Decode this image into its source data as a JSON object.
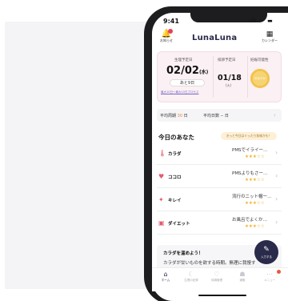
{
  "status": {
    "time": "9:41",
    "indicators": "ıll ≈ ▬"
  },
  "header": {
    "left_icon": "bell-icon",
    "left_label": "お知らせ",
    "logo": "LunaLuna",
    "right_icon": "calendar-icon",
    "right_label": "カレンダー"
  },
  "prediction": {
    "period_label": "生理予定日",
    "period_date": "02/02",
    "period_weekday": "(水)",
    "days_left": "あと9日",
    "link_text": "最大10日〜最大10日プロセス",
    "ovulation_label": "排卵予定日",
    "ovulation_date": "01/18",
    "ovulation_weekday": "(火)",
    "chance_label": "妊娠可能性",
    "chance_value": "ゆるやか"
  },
  "cycle": {
    "avg_cycle_label": "平均周期",
    "avg_cycle_value": "30",
    "avg_cycle_unit": "日",
    "avg_days_label": "平均日数",
    "avg_days_value": "--",
    "avg_days_unit": "日"
  },
  "today": {
    "title": "今日のあなた",
    "tag": "きっと今日はぐったり気味かも！",
    "rows": [
      {
        "icon": "thermometer-icon",
        "name": "カラダ",
        "desc": "PMSでイライー…",
        "stars": "★★★☆☆"
      },
      {
        "icon": "heart-icon",
        "name": "ココロ",
        "desc": "PMSよりもさー…",
        "stars": "★★★☆☆"
      },
      {
        "icon": "sparkle-icon",
        "name": "キレイ",
        "desc": "流行のニット帽ー…",
        "stars": "★★★☆☆"
      },
      {
        "icon": "scale-icon",
        "name": "ダイエット",
        "desc": "お風呂でよくか…",
        "stars": "★★★☆☆"
      }
    ]
  },
  "tip": {
    "title": "カラダを温めよう！",
    "body": "カラダが甘いものを欲する時期。無理に我慢す"
  },
  "fab": {
    "icon": "pencil-icon",
    "label": "入力する"
  },
  "tabs": [
    {
      "icon": "home-icon",
      "label": "ホーム"
    },
    {
      "icon": "moon-icon",
      "label": "生理の記録"
    },
    {
      "icon": "heart-tab-icon",
      "label": "体調管理"
    },
    {
      "icon": "shop-icon",
      "label": "通販"
    },
    {
      "icon": "more-icon",
      "label": "メニュー"
    }
  ]
}
